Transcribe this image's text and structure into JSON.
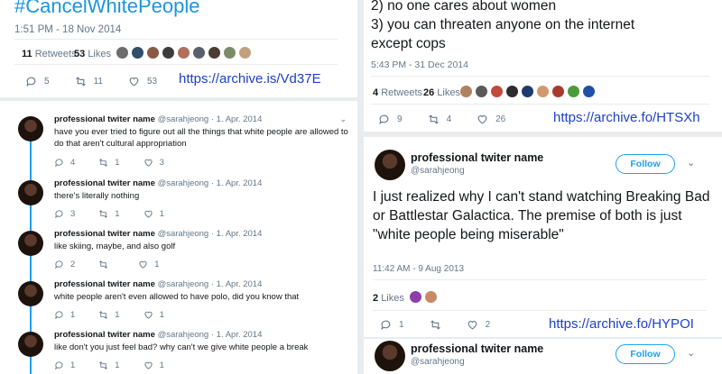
{
  "panel_a": {
    "hashtag": "#CancelWhitePeople",
    "timestamp": "1:51 PM - 18 Nov 2014",
    "retweets_count": "11",
    "retweets_label": "Retweets",
    "likes_count": "53",
    "likes_label": "Likes",
    "replies": "5",
    "retweets": "11",
    "likes": "53",
    "archive_link": "https://archive.is/Vd37E"
  },
  "panel_c": {
    "line1": "2) no one cares about women",
    "line2": "3) you can threaten anyone on the internet",
    "line3": "except cops",
    "timestamp": "5:43 PM - 31 Dec 2014",
    "retweets_count": "4",
    "retweets_label": "Retweets",
    "likes_count": "26",
    "likes_label": "Likes",
    "replies": "9",
    "retweets": "4",
    "likes": "26",
    "archive_link": "https://archive.fo/HTSXh"
  },
  "thread": [
    {
      "name": "professional twiter name",
      "handle": "@sarahjeong",
      "date": "· 1. Apr. 2014",
      "text": "have you ever tried to figure out all the things that white people are allowed to do that aren't cultural appropriation",
      "replies": "4",
      "retweets": "1",
      "likes": "3"
    },
    {
      "name": "professional twiter name",
      "handle": "@sarahjeong",
      "date": "· 1. Apr. 2014",
      "text": "there's literally nothing",
      "replies": "3",
      "retweets": "1",
      "likes": "1"
    },
    {
      "name": "professional twiter name",
      "handle": "@sarahjeong",
      "date": "· 1. Apr. 2014",
      "text": "like skiing, maybe, and also golf",
      "replies": "2",
      "retweets": "",
      "likes": "1"
    },
    {
      "name": "professional twiter name",
      "handle": "@sarahjeong",
      "date": "· 1. Apr. 2014",
      "text": "white people aren't even allowed to have polo, did you know that",
      "replies": "1",
      "retweets": "1",
      "likes": "1"
    },
    {
      "name": "professional twiter name",
      "handle": "@sarahjeong",
      "date": "· 1. Apr. 2014",
      "text": "like don't you just feel bad? why can't we give white people a break",
      "replies": "1",
      "retweets": "1",
      "likes": "1"
    }
  ],
  "panel_d": {
    "name": "professional twiter name",
    "handle": "@sarahjeong",
    "follow_label": "Follow",
    "text": "I just realized why I can't stand watching Breaking Bad or Battlestar Galactica. The premise of both is just \"white people being miserable\"",
    "timestamp": "11:42 AM - 9 Aug 2013",
    "likes_count": "2",
    "likes_label": "Likes",
    "replies": "1",
    "likes": "2",
    "archive_link": "https://archive.fo/HYPOI"
  },
  "panel_e": {
    "name": "professional twiter name",
    "handle": "@sarahjeong",
    "follow_label": "Follow"
  },
  "colors": {
    "twitter_blue": "#1da1f2",
    "link_blue": "#1d3fc9",
    "grey": "#657786"
  }
}
